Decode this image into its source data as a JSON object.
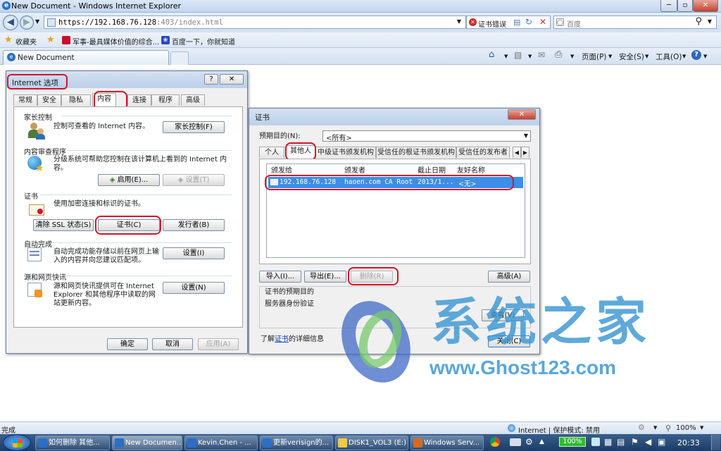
{
  "browser": {
    "title": "New Document - Windows Internet Explorer",
    "url_host": "https://192.168.76.128",
    "url_path": ":403/index.html",
    "cert_error": "证书错误",
    "search_placeholder": "百度",
    "favorites_label": "收藏夹",
    "fav_links": [
      "军事-最具媒体价值的综合...",
      "百度一下，你就知道"
    ],
    "tab_title": "New Document",
    "commands": [
      "页面(P)",
      "安全(S)",
      "工具(O)"
    ]
  },
  "internet_options": {
    "title": "Internet 选项",
    "tabs": [
      "常规",
      "安全",
      "隐私",
      "内容",
      "连接",
      "程序",
      "高级"
    ],
    "active_tab": "内容",
    "parental": {
      "heading": "家长控制",
      "desc": "控制可查看的 Internet 内容。",
      "button": "家长控制(F)"
    },
    "advisor": {
      "heading": "内容审查程序",
      "desc": "分级系统可帮助您控制在该计算机上看到的 Internet 内容。",
      "enable_button": "启用(E)...",
      "settings_button": "设置(T)"
    },
    "certs": {
      "heading": "证书",
      "desc": "使用加密连接和标识的证书。",
      "clear_ssl": "清除 SSL 状态(S)",
      "certs_button": "证书(C)",
      "publishers": "发行者(B)"
    },
    "autocomplete": {
      "heading": "自动完成",
      "desc": "自动完成功能存储以前在网页上输入的内容并向您建议匹配项。",
      "button": "设置(I)"
    },
    "feeds": {
      "heading": "源和网页快讯",
      "desc": "源和网页快讯提供可在 Internet Explorer 和其他程序中读取的网站更新内容。",
      "button": "设置(N)"
    },
    "ok": "确定",
    "cancel": "取消",
    "apply": "应用(A)"
  },
  "certificates": {
    "title": "证书",
    "purpose_label": "预期目的(N):",
    "purpose_value": "<所有>",
    "tabs": [
      "个人",
      "其他人",
      "中级证书颁发机构",
      "受信任的根证书颁发机构",
      "受信任的发布者"
    ],
    "active_tab": "其他人",
    "columns": [
      "颁发给",
      "颁发者",
      "截止日期",
      "友好名称"
    ],
    "rows": [
      {
        "issued_to": "192.168.76.128",
        "issued_by": "haoen.com CA Root",
        "expires": "2013/1...",
        "friendly": "<无>"
      }
    ],
    "import": "导入(I)...",
    "export": "导出(E)...",
    "remove": "删除(R)",
    "advanced": "高级(A)",
    "purposes_heading": "证书的预期目的",
    "purposes_value": "服务器身份验证",
    "view": "查看(V)",
    "learn_prefix": "了解",
    "learn_link": "证书",
    "learn_suffix": "的详细信息",
    "close": "关闭(C)"
  },
  "status": {
    "left": "完成",
    "zone": "Internet | 保护模式: 禁用",
    "zoom": "100%"
  },
  "taskbar": {
    "items": [
      "如何删除 其他...",
      "New Documen...",
      "Kevin.Chen - ...",
      "更新verisign的...",
      "DISK1_VOL3 (E:)",
      "Windows Serv..."
    ],
    "battery": "100%",
    "time": "20:33"
  },
  "watermark": {
    "text": "系统之家",
    "url": "www.Ghost123.com"
  }
}
